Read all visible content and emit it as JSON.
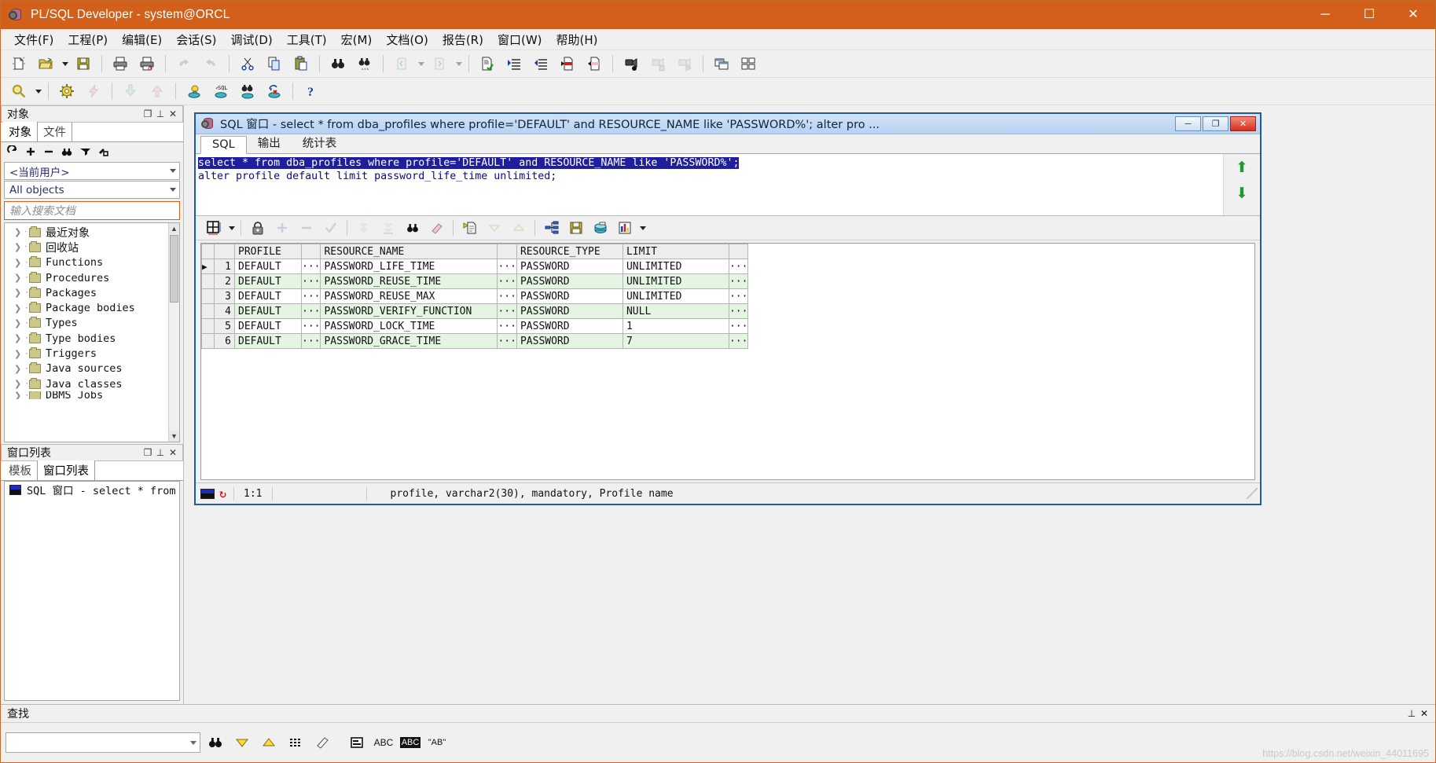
{
  "window": {
    "title": "PL/SQL Developer - system@ORCL",
    "icon": "plsql-developer-icon",
    "controls": {
      "minimize": "─",
      "maximize": "☐",
      "close": "✕"
    }
  },
  "menubar": {
    "items": [
      {
        "name": "file",
        "label": "文件(F)"
      },
      {
        "name": "project",
        "label": "工程(P)"
      },
      {
        "name": "edit",
        "label": "编辑(E)"
      },
      {
        "name": "session",
        "label": "会话(S)"
      },
      {
        "name": "debug",
        "label": "调试(D)"
      },
      {
        "name": "tools",
        "label": "工具(T)"
      },
      {
        "name": "macro",
        "label": "宏(M)"
      },
      {
        "name": "document",
        "label": "文档(O)"
      },
      {
        "name": "report",
        "label": "报告(R)"
      },
      {
        "name": "window",
        "label": "窗口(W)"
      },
      {
        "name": "help",
        "label": "帮助(H)"
      }
    ]
  },
  "toolbar_main": {
    "icons": [
      "new-document-icon",
      "open-folder-icon",
      "open-dropdown-caret",
      "save-icon",
      "print-icon",
      "print-preview-icon",
      "undo-icon",
      "redo-icon",
      "cut-icon",
      "copy-icon",
      "paste-icon",
      "find-icon",
      "find-next-icon",
      "navigate-back-icon",
      "back-dropdown-caret",
      "navigate-forward-icon",
      "forward-dropdown-caret",
      "check-syntax-icon",
      "indent-icon",
      "outdent-icon",
      "breakpoint-set-icon",
      "breakpoint-clear-icon",
      "record-macro-icon",
      "stop-macro-icon",
      "play-macro-icon",
      "window-list-icon",
      "tile-windows-icon"
    ]
  },
  "toolbar_second": {
    "icons": [
      "object-browser-icon",
      "browser-dropdown-caret",
      "settings-icon",
      "lightning-icon",
      "import-icon",
      "export-icon",
      "new-session-icon",
      "new-sql-window-icon",
      "explain-plan-icon",
      "rollback-icon",
      "help-icon"
    ]
  },
  "object_panel": {
    "header": {
      "title": "对象",
      "buttons": [
        "restore-icon",
        "pin-icon",
        "close-icon"
      ]
    },
    "tabs": [
      {
        "name": "objects",
        "label": "对象",
        "active": true
      },
      {
        "name": "files",
        "label": "文件",
        "active": false
      }
    ],
    "mini_toolbar": [
      "refresh-icon",
      "expand-icon",
      "collapse-icon",
      "find-icon",
      "filter-icon",
      "copy-icon"
    ],
    "user_filter": {
      "value": "<当前用户>"
    },
    "object_filter": {
      "value": "All objects"
    },
    "search": {
      "placeholder": "输入搜索文档",
      "value": ""
    },
    "tree": [
      {
        "label": "最近对象",
        "cjk": true
      },
      {
        "label": "回收站",
        "cjk": true
      },
      {
        "label": "Functions",
        "cjk": false
      },
      {
        "label": "Procedures",
        "cjk": false
      },
      {
        "label": "Packages",
        "cjk": false
      },
      {
        "label": "Package bodies",
        "cjk": false
      },
      {
        "label": "Types",
        "cjk": false
      },
      {
        "label": "Type bodies",
        "cjk": false
      },
      {
        "label": "Triggers",
        "cjk": false
      },
      {
        "label": "Java sources",
        "cjk": false
      },
      {
        "label": "Java classes",
        "cjk": false
      },
      {
        "label": "DBMS Jobs",
        "cjk": false
      }
    ]
  },
  "window_list_panel": {
    "header": {
      "title": "窗口列表",
      "buttons": [
        "restore-icon",
        "pin-icon",
        "close-icon"
      ]
    },
    "tabs": [
      {
        "name": "templates",
        "label": "模板",
        "active": false
      },
      {
        "name": "window-list",
        "label": "窗口列表",
        "active": true
      }
    ],
    "items": [
      {
        "label": "SQL 窗口 - select * from db",
        "icon": "sql-window-icon"
      }
    ]
  },
  "sql_window": {
    "title": "SQL 窗口 - select * from dba_profiles where profile='DEFAULT' and RESOURCE_NAME like 'PASSWORD%'; alter pro ...",
    "controls": {
      "minimize": "─",
      "maximize": "❐",
      "close": "✕"
    },
    "tabs": [
      {
        "name": "sql",
        "label": "SQL",
        "active": true
      },
      {
        "name": "output",
        "label": "输出",
        "active": false
      },
      {
        "name": "statistics",
        "label": "统计表",
        "active": false
      }
    ],
    "editor": {
      "lines": [
        {
          "text": "select * from dba_profiles where profile='DEFAULT' and RESOURCE_NAME like 'PASSWORD%';",
          "selected": true
        },
        {
          "text": "alter profile default limit password_life_time unlimited;",
          "selected": false
        }
      ],
      "scroll_buttons": [
        "scroll-up-arrow-icon",
        "scroll-down-arrow-icon"
      ]
    },
    "grid_toolbar": {
      "icons": [
        "grid-layout-icon",
        "grid-dropdown-caret",
        "lock-icon",
        "add-record-icon",
        "delete-record-icon",
        "post-record-icon",
        "export-down-icon",
        "export-all-icon",
        "find-icon",
        "clear-icon",
        "duplicate-row-icon",
        "sort-desc-icon",
        "sort-asc-icon",
        "query-builder-icon",
        "save-icon",
        "database-icon",
        "chart-icon",
        "chart-dropdown-caret"
      ]
    },
    "grid": {
      "columns": [
        "PROFILE",
        "RESOURCE_NAME",
        "RESOURCE_TYPE",
        "LIMIT"
      ],
      "rows": [
        {
          "n": "1",
          "current": true,
          "PROFILE": "DEFAULT",
          "RESOURCE_NAME": "PASSWORD_LIFE_TIME",
          "RESOURCE_TYPE": "PASSWORD",
          "LIMIT": "UNLIMITED"
        },
        {
          "n": "2",
          "current": false,
          "PROFILE": "DEFAULT",
          "RESOURCE_NAME": "PASSWORD_REUSE_TIME",
          "RESOURCE_TYPE": "PASSWORD",
          "LIMIT": "UNLIMITED"
        },
        {
          "n": "3",
          "current": false,
          "PROFILE": "DEFAULT",
          "RESOURCE_NAME": "PASSWORD_REUSE_MAX",
          "RESOURCE_TYPE": "PASSWORD",
          "LIMIT": "UNLIMITED"
        },
        {
          "n": "4",
          "current": false,
          "PROFILE": "DEFAULT",
          "RESOURCE_NAME": "PASSWORD_VERIFY_FUNCTION",
          "RESOURCE_TYPE": "PASSWORD",
          "LIMIT": "NULL"
        },
        {
          "n": "5",
          "current": false,
          "PROFILE": "DEFAULT",
          "RESOURCE_NAME": "PASSWORD_LOCK_TIME",
          "RESOURCE_TYPE": "PASSWORD",
          "LIMIT": "1"
        },
        {
          "n": "6",
          "current": false,
          "PROFILE": "DEFAULT",
          "RESOURCE_NAME": "PASSWORD_GRACE_TIME",
          "RESOURCE_TYPE": "PASSWORD",
          "LIMIT": "7"
        }
      ],
      "ellipsis": "···"
    },
    "status": {
      "position": "1:1",
      "field_info": "profile, varchar2(30), mandatory, Profile name"
    }
  },
  "find_panel": {
    "header": {
      "title": "查找",
      "buttons": [
        "pin-icon",
        "close-icon"
      ]
    },
    "input": {
      "value": "",
      "placeholder": ""
    },
    "buttons": [
      {
        "name": "find-icon",
        "label": ""
      },
      {
        "name": "find-next-down-icon",
        "label": ""
      },
      {
        "name": "find-previous-up-icon",
        "label": ""
      },
      {
        "name": "find-all-grid-icon",
        "label": ""
      },
      {
        "name": "clear-eraser-icon",
        "label": ""
      },
      {
        "name": "find-in-window-icon",
        "label": ""
      },
      {
        "name": "match-case-abc-icon",
        "label": "ABC"
      },
      {
        "name": "highlight-abc-icon",
        "label": "ABC"
      },
      {
        "name": "whole-word-icon",
        "label": "\"AB\""
      }
    ]
  },
  "watermark": "https://blog.csdn.net/weixin_44011695",
  "colors": {
    "titlebar": "#d2601a",
    "mdi_border": "#2159a5",
    "selection": "#1f1f9e",
    "sql_text": "#0a0a8a",
    "alt_row": "#e4f5e2"
  }
}
